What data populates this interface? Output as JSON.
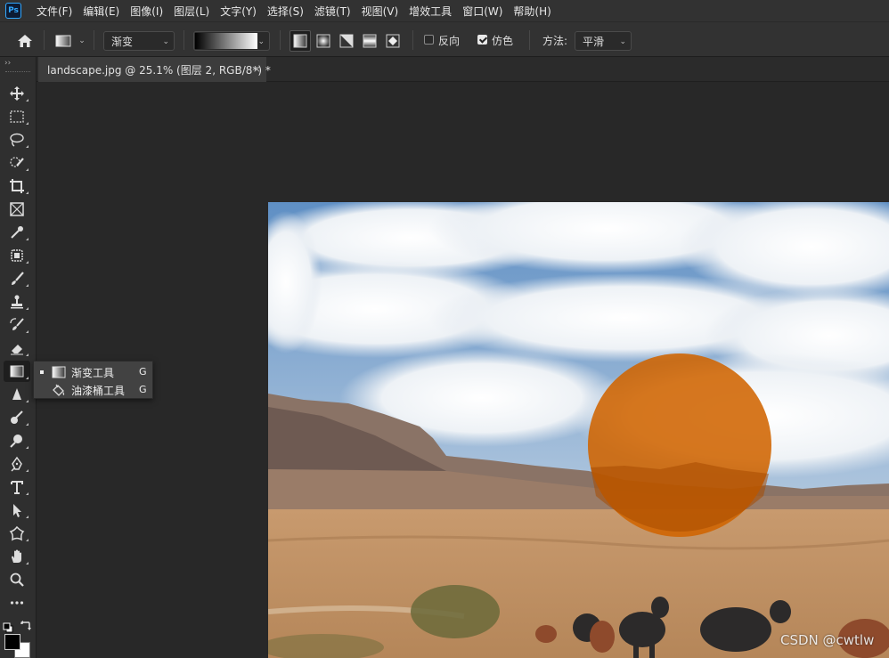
{
  "app": {
    "logo": "Ps"
  },
  "menu": [
    "文件(F)",
    "编辑(E)",
    "图像(I)",
    "图层(L)",
    "文字(Y)",
    "选择(S)",
    "滤镜(T)",
    "视图(V)",
    "增效工具",
    "窗口(W)",
    "帮助(H)"
  ],
  "options": {
    "preset_mode": "渐变",
    "reverse_label": "反向",
    "reverse_checked": false,
    "dither_label": "仿色",
    "dither_checked": true,
    "method_label": "方法:",
    "method_value": "平滑"
  },
  "document_tab": {
    "title": "landscape.jpg @ 25.1% (图层 2, RGB/8*) *",
    "close": "×"
  },
  "toolbar": {
    "collapse": "››"
  },
  "flyout": {
    "items": [
      {
        "label": "渐变工具",
        "key": "G",
        "active": true,
        "icon": "gradient-icon"
      },
      {
        "label": "油漆桶工具",
        "key": "G",
        "active": false,
        "icon": "paint-bucket-icon"
      }
    ]
  },
  "colors": {
    "foreground": "#000000",
    "background": "#ffffff",
    "circle": "#d06400"
  },
  "watermark": "CSDN @cwtlw"
}
